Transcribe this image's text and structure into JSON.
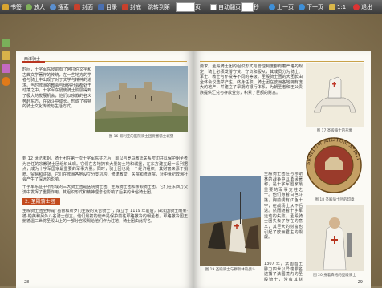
{
  "toolbar": {
    "bookmark": "书签",
    "zoom_in": "放大",
    "search": "搜索",
    "cover": "封面",
    "toc": "目录",
    "back_cover": "封底",
    "jump_to": "跳转到第",
    "page_unit": "页",
    "autoplay": "自动翻页",
    "seconds_unit": "秒",
    "prev": "上一页",
    "next": "下一页",
    "ratio": "1:1",
    "exit": "退出"
  },
  "left_page": {
    "running_head": "西洋骑士",
    "body_top": "时间，十字军东侵前有了阿拉伯文字和古典文学著作的传统，在一些地方的学者与骑士中出现了对于文学与精神的追求。当时欧洲的教会与世俗社会都处于动荡之中，十字军东侵使骑士阶层得到了极大的发展机会，他们以宗教的名义奔赴东方，在战斗中成长，形成了独特的骑士文化传统与生活方式。",
    "caption_castle": "图 16 叙利亚的医院骑士团要塞骑士城堡",
    "body_mid": "到 12 世纪末期，骑士团在第一次十字军东征之后，即以与罗马教廷关系密切并以保护朝圣者为己任的宗教骑士团组织出现。它们在各地拥有大量的土地和城堡，在东方建立起一系列据点，成为十字军国家最重要的军事力量。同时，骑士团也是一个经济组织，其财富来源于捐赠、贸易和征战。它们在欧洲各地设立分支机构，修建教堂、医院和修道院，对中世纪欧洲社会产生了深远的影响。",
    "body_low": "十字军东征中所形成的三大骑士团是医院骑士团、圣殿骑士团和条顿骑士团。它们在东西方交流中发挥了重要作用，其组织形式和精神理念也影响了后来的世俗骑士团。",
    "section_heading": "2. 圣殿骑士团",
    "body_section": "圣殿骑士团全称是“基督和所罗门圣殿的贫苦骑士”，成立于 1119 年前后，由法国骑士雨果·德·帕英和另外八名骑士创立。他们最初的使命是保护前往耶路撒冷的朝圣者。耶路撒冷国王鲍德温二世将圣殿山上的一部分宫殿赐给他们作为驻地，骑士团由此得名。",
    "page_number": "28"
  },
  "right_page": {
    "body_top": "要求。圣殿骑士团的组织形式与管理制度都有着严格的规定，骑士必须发誓守贫、守贞和服从，其成员分为骑士、军士、教士与仆役等不同的等级。圣殿骑士团的大团长由全体会议选举产生，终身任职。骑士团在欧洲各地拥有庞大的地产，并建立了早期的银行体系，为朝圣者和王公贵族提供汇兑与存款业务，积累了巨额的财富。",
    "caption_knight": "图 17 圣殿骑士的形象",
    "body_mid": "圣殿骑士团在与穆斯林的战争中以勇猛著称，是十字军国家最重要的军事支柱之一。他们身着白色斗篷，胸前绣有红色十字，在战场上从不后退。然而随着十字军运动的失败，圣殿骑士团失去了存在的意义，其巨大的财富也引起了欧洲君主的觊觎。",
    "caption_seal": "图 18 圣殿骑士团的印章",
    "body_low": "1307 年，法国国王腓力四世以异端罪名逮捕了法国境内的圣殿骑士，没收其财产。1312 年，教皇克莱门特五世正式宣布解散圣殿骑士团，其大部分财产被转交给医院骑士团。",
    "caption_battle": "图 19 圣殿骑士与穆斯林的战斗",
    "caption_monk": "图 20 身着白袍的圣殿骑士",
    "page_number": "29"
  },
  "images": {
    "seal_text": "SIGILLUM MILITUM XPISTI"
  }
}
